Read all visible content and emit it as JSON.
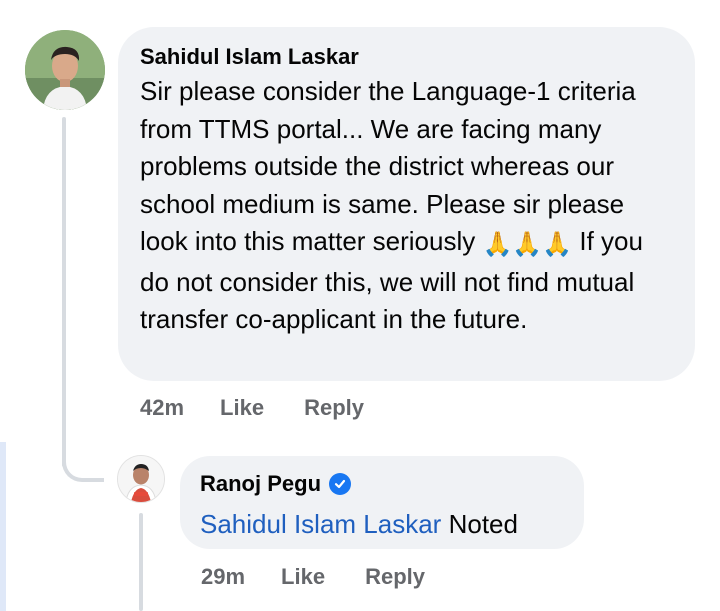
{
  "comment": {
    "author": "Sahidul Islam Laskar",
    "text_before_emoji": "Sir please consider the Language-1 criteria from TTMS portal... We are facing many problems outside the district whereas our school medium is same. Please sir please look into this matter seriously",
    "emoji": "🙏🙏🙏",
    "text_after_emoji": "If you do not consider this, we will not find mutual transfer co-applicant in the future.",
    "time": "42m",
    "like_label": "Like",
    "reply_label": "Reply"
  },
  "reply": {
    "author": "Ranoj Pegu",
    "mention": "Sahidul Islam Laskar",
    "text": "Noted",
    "time": "29m",
    "like_label": "Like",
    "reply_label": "Reply"
  },
  "colors": {
    "bubble_bg": "#f0f2f5",
    "mention_blue": "#1f5fbf",
    "verified_blue": "#1877f2",
    "meta_gray": "#65676b"
  }
}
